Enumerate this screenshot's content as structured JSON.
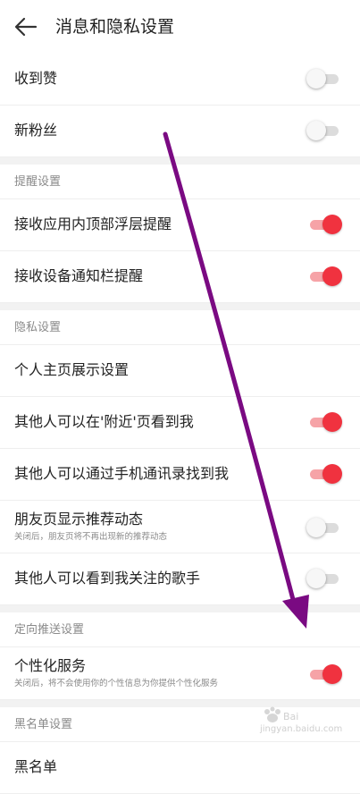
{
  "header": {
    "title": "消息和隐私设置",
    "back_icon": "back-arrow-icon"
  },
  "rows_top": [
    {
      "label": "收到赞",
      "toggle": "off"
    },
    {
      "label": "新粉丝",
      "toggle": "off"
    }
  ],
  "reminder": {
    "title": "提醒设置",
    "rows": [
      {
        "label": "接收应用内顶部浮层提醒",
        "toggle": "on"
      },
      {
        "label": "接收设备通知栏提醒",
        "toggle": "on"
      }
    ]
  },
  "privacy": {
    "title": "隐私设置",
    "rows": [
      {
        "label": "个人主页展示设置"
      },
      {
        "label": "其他人可以在'附近'页看到我",
        "toggle": "on"
      },
      {
        "label": "其他人可以通过手机通讯录找到我",
        "toggle": "on"
      },
      {
        "label": "朋友页显示推荐动态",
        "sub": "关闭后，朋友页将不再出现新的推荐动态",
        "toggle": "off"
      },
      {
        "label": "其他人可以看到我关注的歌手",
        "toggle": "off"
      }
    ]
  },
  "targeting": {
    "title": "定向推送设置",
    "rows": [
      {
        "label": "个性化服务",
        "sub": "关闭后，将不会使用你的个性信息为你提供个性化服务",
        "toggle": "on"
      }
    ]
  },
  "blacklist": {
    "title": "黑名单设置",
    "rows": [
      {
        "label": "黑名单"
      }
    ]
  },
  "watermark": {
    "text": "jingyan.baidu.com"
  },
  "colors": {
    "toggle_on": "#f0323f",
    "toggle_on_track": "#f6a3a7",
    "toggle_off_track": "#dcdcdc",
    "annotation_arrow": "#7a0a82"
  }
}
